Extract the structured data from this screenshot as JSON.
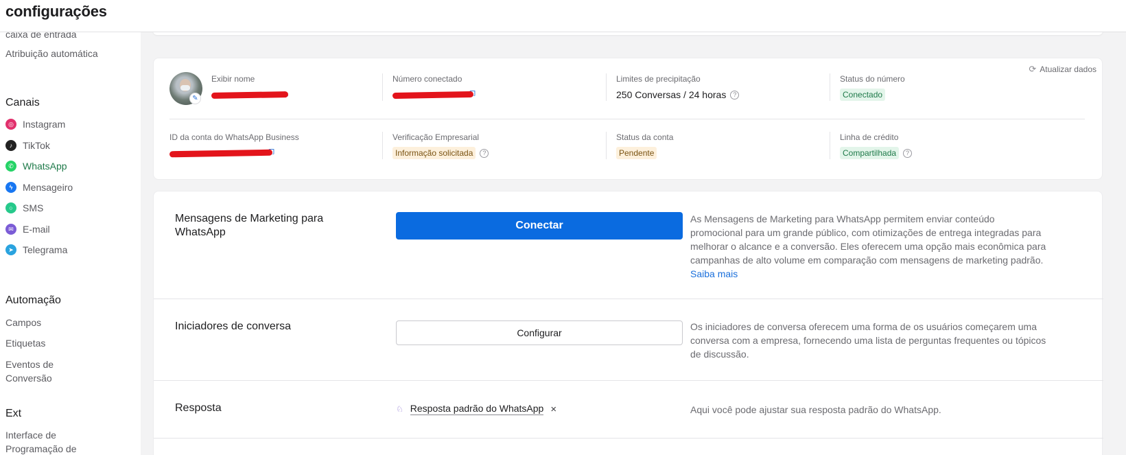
{
  "header": {
    "title": "configurações"
  },
  "sidebar": {
    "inbox_cut": "caixa de entrada",
    "auto_assign": "Atribuição automática",
    "channels_heading": "Canais",
    "channels": [
      {
        "label": "Instagram",
        "icon": "instagram-icon",
        "color": "#e1306c"
      },
      {
        "label": "TikTok",
        "icon": "tiktok-icon",
        "color": "#222222"
      },
      {
        "label": "WhatsApp",
        "icon": "whatsapp-icon",
        "color": "#25d366"
      },
      {
        "label": "Mensageiro",
        "icon": "messenger-icon",
        "color": "#1877f2"
      },
      {
        "label": "SMS",
        "icon": "sms-icon",
        "color": "#26c98b"
      },
      {
        "label": "E-mail",
        "icon": "email-icon",
        "color": "#7b5cd6"
      },
      {
        "label": "Telegrama",
        "icon": "telegram-icon",
        "color": "#2aa3df"
      }
    ],
    "automation_heading": "Automação",
    "automation": [
      "Campos",
      "Etiquetas",
      "Eventos de Conversão"
    ],
    "ext_heading": "Ext",
    "ext_items": [
      "Interface de Programação de"
    ]
  },
  "account": {
    "refresh_label": "Atualizar dados",
    "display_name_label": "Exibir nome",
    "connected_number_label": "Número conectado",
    "rate_limits_label": "Limites de precipitação",
    "rate_limits_value": "250 Conversas / 24 horas",
    "number_status_label": "Status do número",
    "number_status_value": "Conectado",
    "business_id_label": "ID da conta do WhatsApp Business",
    "verification_label": "Verificação Empresarial",
    "verification_value": "Informação solicitada",
    "account_status_label": "Status da conta",
    "account_status_value": "Pendente",
    "credit_line_label": "Linha de crédito",
    "credit_line_value": "Compartilhada"
  },
  "rows": {
    "marketing": {
      "title": "Mensagens de Marketing para WhatsApp",
      "button": "Conectar",
      "description": "As Mensagens de Marketing para WhatsApp permitem enviar conteúdo promocional para um grande público, com otimizações de entrega integradas para melhorar o alcance e a conversão. Eles oferecem uma opção mais econômica para campanhas de alto volume em comparação com mensagens de marketing padrão.",
      "link": "Saiba mais"
    },
    "starters": {
      "title": "Iniciadores de conversa",
      "button": "Configurar",
      "description": "Os iniciadores de conversa oferecem uma forma de os usuários começarem uma conversa com a empresa, fornecendo uma lista de perguntas frequentes ou tópicos de discussão."
    },
    "reply": {
      "title": "Resposta",
      "chip": "Resposta padrão do WhatsApp",
      "description": "Aqui você pode ajustar sua resposta padrão do WhatsApp."
    }
  }
}
